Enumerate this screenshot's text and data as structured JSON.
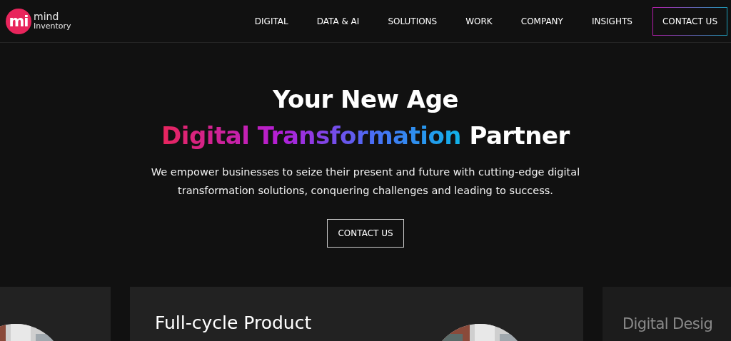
{
  "header": {
    "logo": {
      "mark": "mi",
      "line_1": "mind",
      "line_2": "Inventory"
    },
    "nav": [
      {
        "label": "DIGITAL"
      },
      {
        "label": "DATA & AI"
      },
      {
        "label": "SOLUTIONS"
      },
      {
        "label": "WORK"
      },
      {
        "label": "COMPANY"
      },
      {
        "label": "INSIGHTS"
      }
    ],
    "cta": "CONTACT US"
  },
  "hero": {
    "title_line_1": "Your New Age",
    "title_gradient": "Digital Transformation",
    "title_end": "Partner",
    "description": "We empower businesses to seize their present and future with cutting-edge digital transformation solutions, conquering challenges and leading to success.",
    "button": "CONTACT US"
  },
  "cards": [
    {
      "kind": "picture-only"
    },
    {
      "kind": "featured",
      "title": "Full-cycle Product"
    },
    {
      "kind": "faded",
      "title": "Digital Desig"
    }
  ]
}
